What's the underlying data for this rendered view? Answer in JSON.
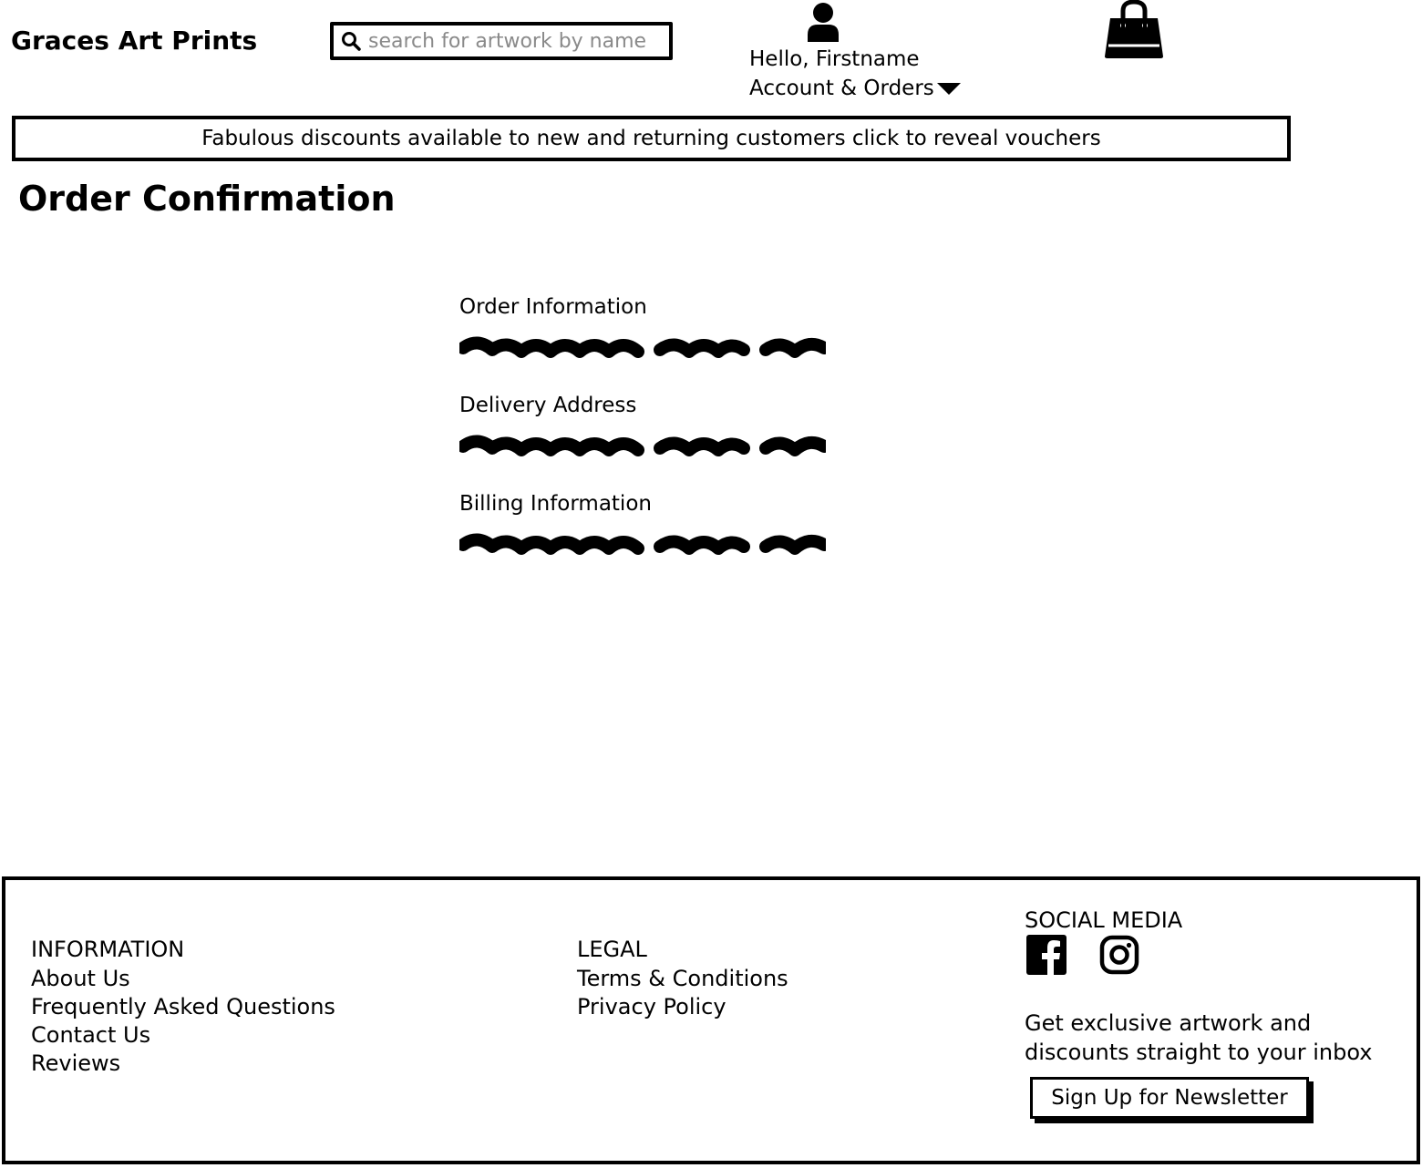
{
  "header": {
    "brand": "Graces Art Prints",
    "search": {
      "placeholder": "search for artwork by name",
      "value": ""
    },
    "greeting": "Hello, Firstname",
    "account_menu_label": "Account & Orders",
    "icons": [
      "search-icon",
      "user-icon",
      "caret-down-icon",
      "shopping-bag-icon"
    ]
  },
  "promo_banner": {
    "text": "Fabulous discounts available to new and returning customers click to reveal vouchers"
  },
  "main": {
    "page_title": "Order Confirmation",
    "sections": [
      {
        "label": "Order Information"
      },
      {
        "label": "Delivery Address"
      },
      {
        "label": "Billing Information"
      }
    ]
  },
  "footer": {
    "information": {
      "heading": "INFORMATION",
      "links": [
        "About Us",
        "Frequently Asked Questions",
        "Contact Us",
        "Reviews"
      ]
    },
    "legal": {
      "heading": "LEGAL",
      "links": [
        "Terms & Conditions",
        "Privacy Policy"
      ]
    },
    "social": {
      "heading": "SOCIAL MEDIA",
      "icons": [
        "facebook-icon",
        "instagram-icon"
      ]
    },
    "newsletter": {
      "text_line1": "Get exclusive artwork and",
      "text_line2": "discounts straight to your inbox",
      "button_label": "Sign Up for Newsletter"
    }
  }
}
